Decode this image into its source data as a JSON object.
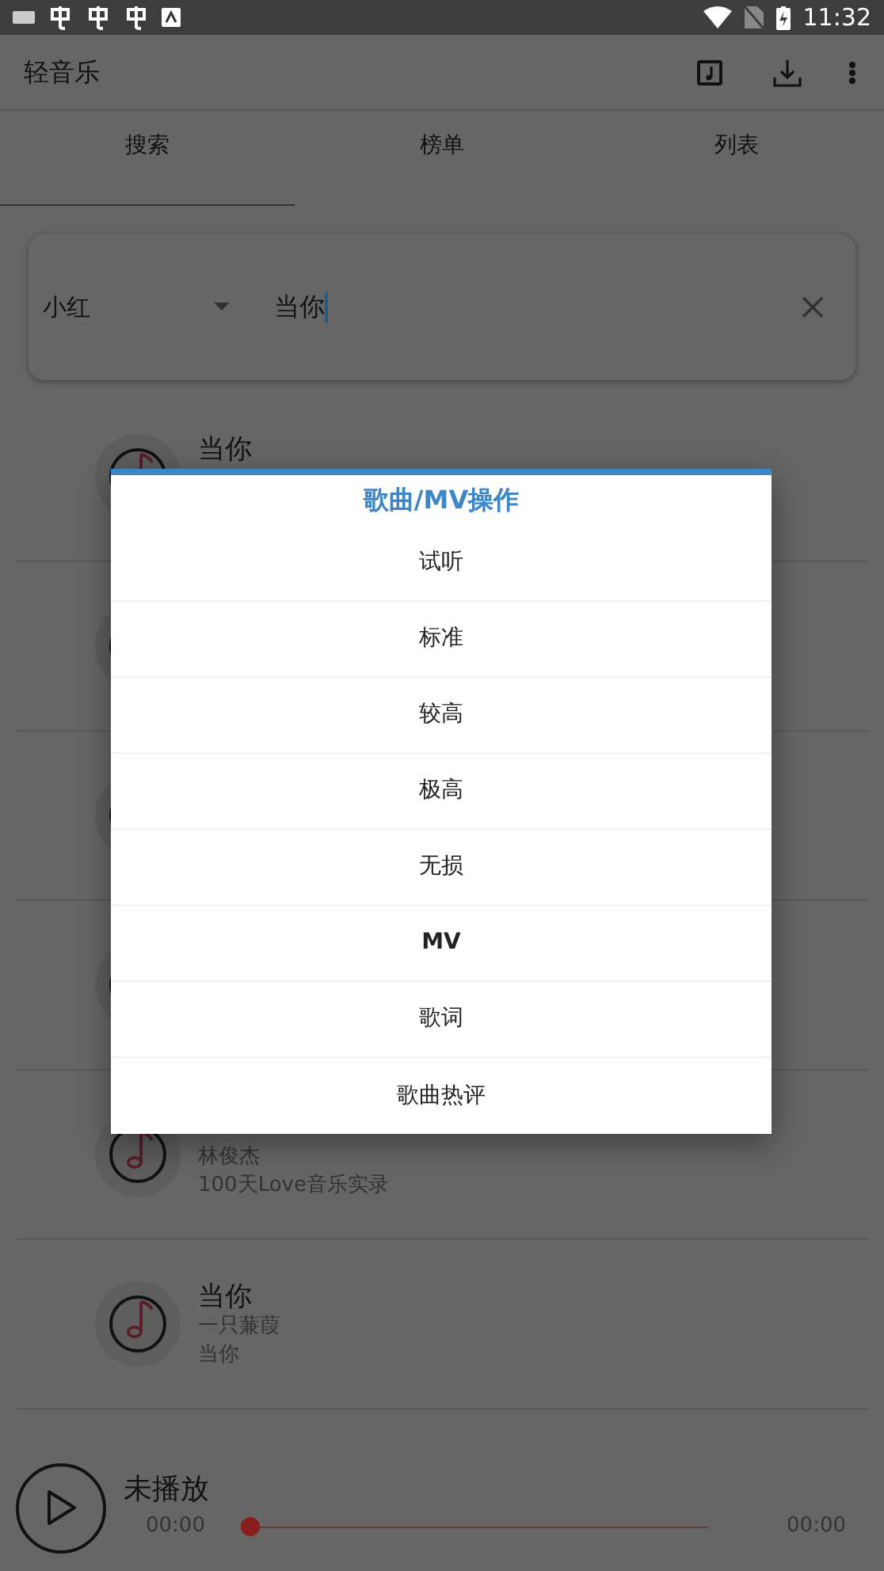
{
  "status_bar": {
    "time": "11:32"
  },
  "app_bar": {
    "title": "轻音乐"
  },
  "tabs": [
    {
      "label": "搜索",
      "selected": true
    },
    {
      "label": "榜单",
      "selected": false
    },
    {
      "label": "列表",
      "selected": false
    }
  ],
  "search": {
    "source": "小红",
    "value": "当你"
  },
  "songs": [
    {
      "kind": "song",
      "title": "当你"
    },
    {
      "kind": "song"
    },
    {
      "kind": "song"
    },
    {
      "kind": "song"
    },
    {
      "kind": "song",
      "artist": "林俊杰",
      "album": "100天Love音乐实录"
    },
    {
      "kind": "song",
      "title": "当你",
      "artist": "一只蒹葭",
      "album": "当你"
    }
  ],
  "dialog": {
    "title": "歌曲/MV操作",
    "items": [
      {
        "label": "试听",
        "bold": false
      },
      {
        "label": "标准",
        "bold": false
      },
      {
        "label": "较高",
        "bold": false
      },
      {
        "label": "极高",
        "bold": false
      },
      {
        "label": "无损",
        "bold": false
      },
      {
        "label": "MV",
        "bold": true
      },
      {
        "label": "歌词",
        "bold": false
      },
      {
        "label": "歌曲热评",
        "bold": false
      }
    ]
  },
  "player": {
    "status": "未播放",
    "elapsed": "00:00",
    "duration": "00:00",
    "level": 0
  }
}
